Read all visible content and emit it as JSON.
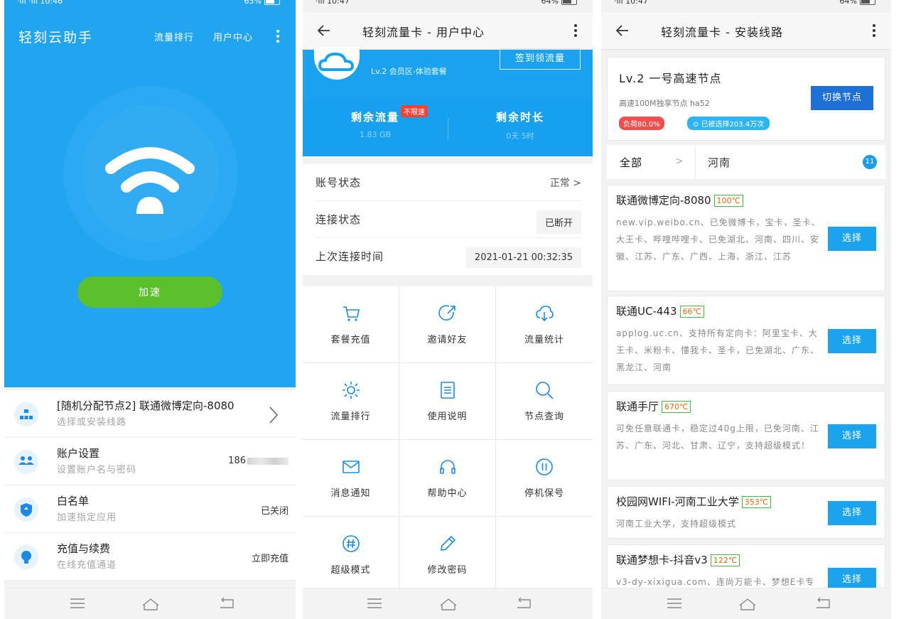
{
  "status": {
    "s1": {
      "left": "·ııl ·ııl 10:46",
      "right": "65%"
    },
    "s2": {
      "left": "·ııl 10:47",
      "right": "64%"
    },
    "s3": {
      "left": "·ııl 10:47",
      "right": "64%"
    }
  },
  "screen1": {
    "app_title": "轻刻云助手",
    "link_rank": "流量排行",
    "link_user": "用户中心",
    "speed_button": "加速",
    "items": [
      {
        "title": "[随机分配节点2] 联通微博定向-8080",
        "subtitle": "选择或安装线路",
        "value": ""
      },
      {
        "title": "账户设置",
        "subtitle": "设置账户名与密码",
        "value": "186"
      },
      {
        "title": "白名单",
        "subtitle": "加速指定应用",
        "value": "已关闭"
      },
      {
        "title": "充值与续费",
        "subtitle": "在线充值通道",
        "value": "立即充值"
      }
    ]
  },
  "screen2": {
    "header_title": "轻刻流量卡 - 用户中心",
    "level": "Lv.2 会员区-体验套餐",
    "sign_button": "签到领流量",
    "remaining_traffic_label": "剩余流量",
    "unlimited_badge": "不限速",
    "remaining_traffic_value": "1.83 GB",
    "remaining_time_label": "剩余时长",
    "remaining_time_value": "0天 5时",
    "rows": [
      {
        "key": "账号状态",
        "value": "正常 >"
      },
      {
        "key": "连接状态",
        "value": "已断开"
      },
      {
        "key": "上次连接时间",
        "value": "2021-01-21 00:32:35"
      }
    ],
    "grid": [
      "套餐充值",
      "邀请好友",
      "流量统计",
      "流量排行",
      "使用说明",
      "节点查询",
      "消息通知",
      "帮助中心",
      "停机保号",
      "超级模式",
      "修改密码"
    ]
  },
  "screen3": {
    "header_title": "轻刻流量卡 - 安装线路",
    "node_title": "Lv.2 一号高速节点",
    "node_sub": "高速100M独享节点 ha52",
    "switch_button": "切换节点",
    "load_tag": "负荷80.0%",
    "selected_tag": "已被选择203.4万次",
    "filter_all": "全部",
    "filter_province": "河南",
    "filter_count": "11",
    "select_label": "选择",
    "routes": [
      {
        "name": "联通微博定向-8080",
        "temp": "100℃",
        "desc": "new.vip.weibo.cn、已免微博卡，宝卡，圣卡、大王卡、哔哩哔哩卡、已免湖北、河南、四川、安徽、江苏、广东、广西、上海、浙江、江苏"
      },
      {
        "name": "联通UC-443",
        "temp": "66℃",
        "desc": "applog.uc.cn、支持所有定向卡：阿里宝卡、大王卡、米粉卡、懂我卡、圣卡，已免湖北、广东、黑龙江、河南"
      },
      {
        "name": "联通手厅",
        "temp": "670℃",
        "desc": "可免任意联通卡，稳定过40g上限，已免河南、江苏、广东、河北、甘肃、辽宁，支持超级模式！"
      },
      {
        "name": "校园网WIFI-河南工业大学",
        "temp": "353℃",
        "desc": "河南工业大学，支持超级模式"
      },
      {
        "name": "联通梦想卡-抖音v3",
        "temp": "122℃",
        "desc": "v3-dy-xixigua.com、连尚万能卡、梦想E卡专"
      }
    ]
  }
}
